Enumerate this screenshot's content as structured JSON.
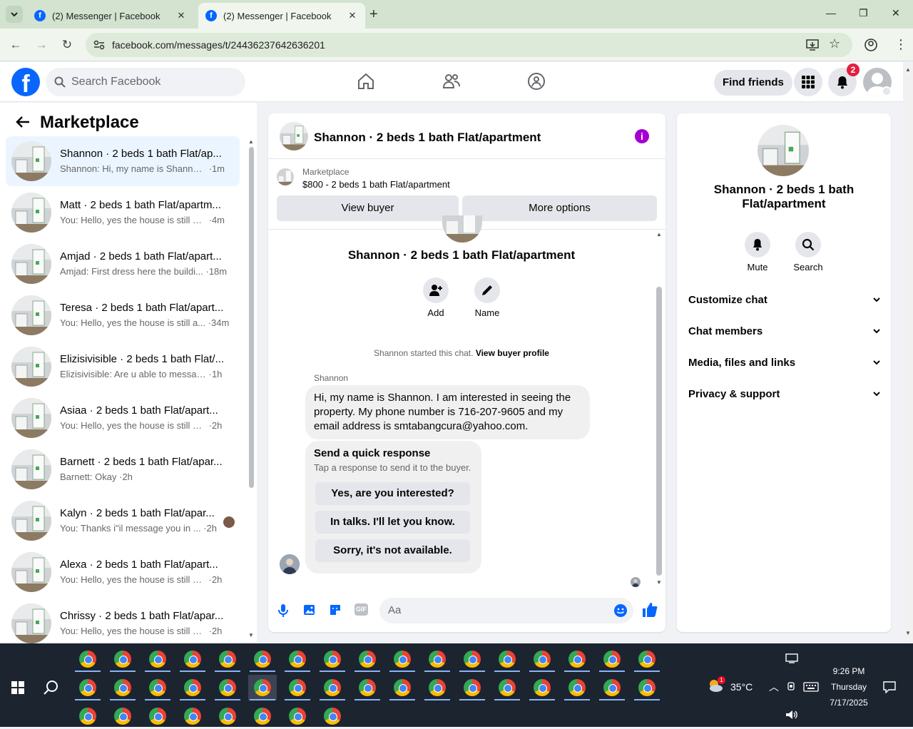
{
  "browser": {
    "tabs": [
      {
        "title": "(2) Messenger | Facebook",
        "active": false
      },
      {
        "title": "(2) Messenger | Facebook",
        "active": true
      }
    ],
    "url": "facebook.com/messages/t/24436237642636201"
  },
  "fb": {
    "search_placeholder": "Search Facebook",
    "find_friends": "Find friends",
    "notif_count": "2"
  },
  "sidebar": {
    "title": "Marketplace",
    "conversations": [
      {
        "name": "Shannon · 2 beds 1 bath Flat/ap...",
        "preview": "Shannon: Hi, my name is Shannon....",
        "time": "1m",
        "selected": true
      },
      {
        "name": "Matt · 2 beds 1 bath Flat/apartm...",
        "preview": "You: Hello, yes the house is still av...",
        "time": "4m"
      },
      {
        "name": "Amjad · 2 beds 1 bath Flat/apart...",
        "preview": "Amjad: First dress here the buildi...",
        "time": "18m"
      },
      {
        "name": "Teresa · 2 beds 1 bath Flat/apart...",
        "preview": "You: Hello, yes the house is still a...",
        "time": "34m"
      },
      {
        "name": "Elizisivisible · 2 beds 1 bath Flat/...",
        "preview": "Elizisivisible: Are u able to message...",
        "time": "1h"
      },
      {
        "name": "Asiaa · 2 beds 1 bath Flat/apart...",
        "preview": "You: Hello, yes the house is still avai...",
        "time": "2h"
      },
      {
        "name": "Barnett · 2 beds 1 bath Flat/apar...",
        "preview": "Barnett: Okay",
        "time": "2h"
      },
      {
        "name": "Kalyn · 2 beds 1 bath Flat/apar...",
        "preview": "You: Thanks i\"il message you in ...",
        "time": "2h"
      },
      {
        "name": "Alexa · 2 beds 1 bath Flat/apart...",
        "preview": "You: Hello, yes the house is still avai...",
        "time": "2h"
      },
      {
        "name": "Chrissy · 2 beds 1 bath Flat/apar...",
        "preview": "You: Hello, yes the house is still avai...",
        "time": "2h"
      }
    ]
  },
  "chat": {
    "title": "Shannon · 2 beds 1 bath Flat/apartment",
    "marketplace_label": "Marketplace",
    "listing": "$800 - 2 beds 1 bath Flat/apartment",
    "view_buyer": "View buyer",
    "more_options": "More options",
    "center_name": "Shannon · 2 beds 1 bath Flat/apartment",
    "add_label": "Add",
    "name_label": "Name",
    "system_text": "Shannon started this chat.",
    "system_link": "View buyer profile",
    "sender": "Shannon",
    "message": "Hi, my name is Shannon.  I am interested in seeing the property. My phone number is 716-207-9605 and my email address is smtabangcura@yahoo.com.",
    "quick_title": "Send a quick response",
    "quick_sub": "Tap a response to send it to the buyer.",
    "quick_responses": [
      "Yes, are you interested?",
      "In talks. I'll let you know.",
      "Sorry, it's not available."
    ],
    "input_placeholder": "Aa"
  },
  "details": {
    "name": "Shannon · 2 beds 1 bath Flat/apartment",
    "mute": "Mute",
    "search": "Search",
    "sections": [
      "Customize chat",
      "Chat members",
      "Media, files and links",
      "Privacy & support"
    ]
  },
  "taskbar": {
    "temperature": "35°C",
    "weather_badge": "1",
    "time": "9:26 PM",
    "day": "Thursday",
    "date": "7/17/2025"
  }
}
